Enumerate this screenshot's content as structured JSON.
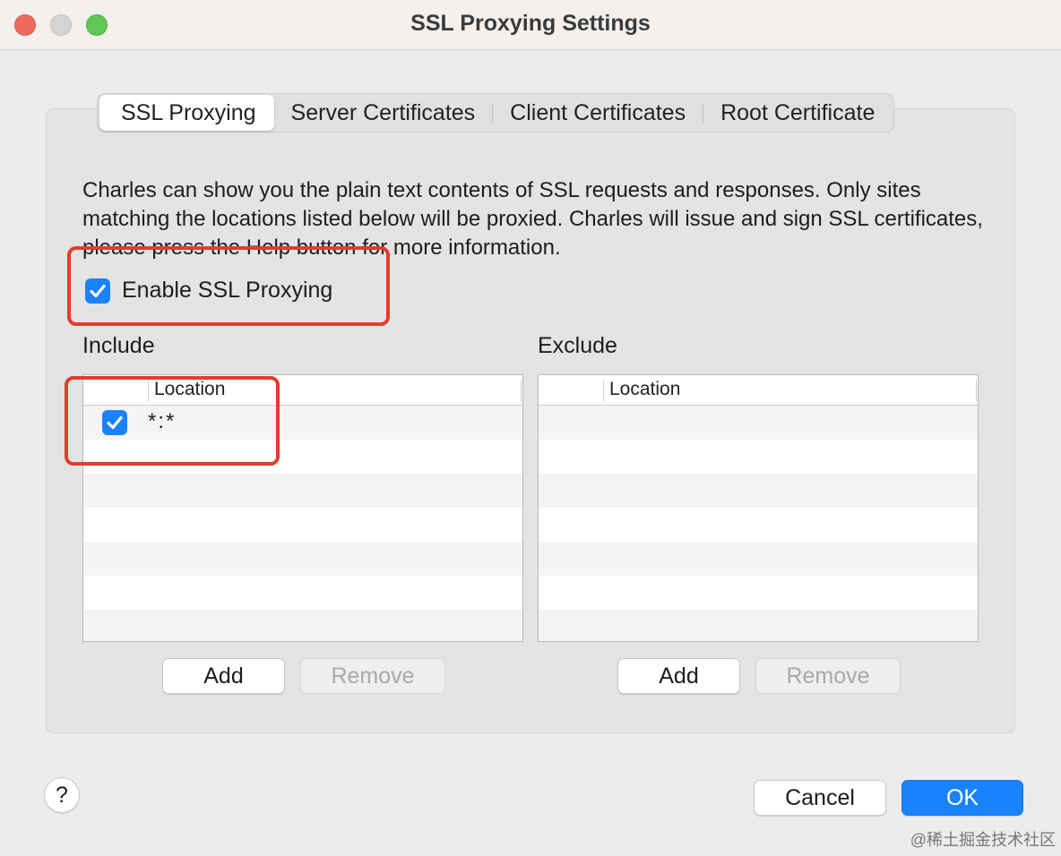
{
  "window": {
    "title": "SSL Proxying Settings"
  },
  "tabs": [
    {
      "label": "SSL Proxying",
      "active": true
    },
    {
      "label": "Server Certificates",
      "active": false
    },
    {
      "label": "Client Certificates",
      "active": false
    },
    {
      "label": "Root Certificate",
      "active": false
    }
  ],
  "description": "Charles can show you the plain text contents of SSL requests and responses. Only sites matching the locations listed below will be proxied. Charles will issue and sign SSL certificates, please press the Help button for more information.",
  "enable_ssl": {
    "label": "Enable SSL Proxying",
    "checked": true
  },
  "include": {
    "label": "Include",
    "column_header": "Location",
    "rows": [
      {
        "enabled": true,
        "location": "*:*"
      }
    ],
    "add_label": "Add",
    "remove_label": "Remove",
    "remove_enabled": false
  },
  "exclude": {
    "label": "Exclude",
    "column_header": "Location",
    "rows": [],
    "add_label": "Add",
    "remove_label": "Remove",
    "remove_enabled": false
  },
  "footer": {
    "help_label": "?",
    "cancel_label": "Cancel",
    "ok_label": "OK"
  },
  "colors": {
    "accent": "#1a82fb",
    "highlight": "#e23d2e"
  },
  "watermark": "@稀土掘金技术社区"
}
